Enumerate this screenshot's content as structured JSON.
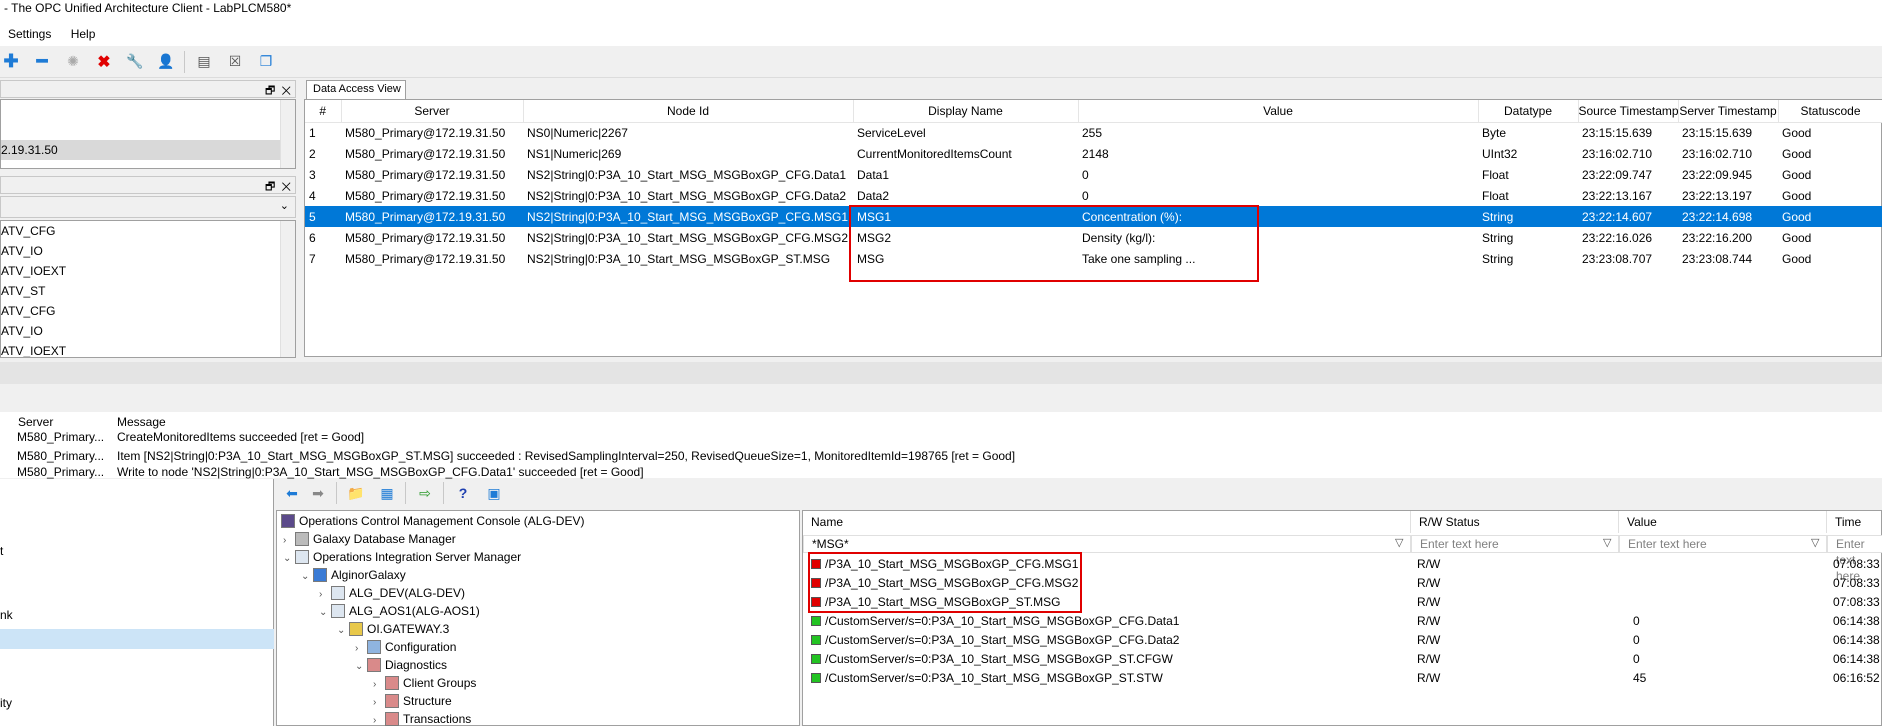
{
  "window": {
    "title": "- The OPC Unified Architecture Client - LabPLCM580*"
  },
  "menu": {
    "items": [
      "Settings",
      "Help"
    ]
  },
  "toolbar": {
    "icons": [
      "add-icon",
      "remove-icon",
      "connect-icon",
      "disconnect-icon",
      "wrench-icon",
      "user-icon",
      "document-icon",
      "delete-doc-icon",
      "window-icon"
    ]
  },
  "left_panel_top": {
    "selected_item": "2.19.31.50"
  },
  "left_panel_tree": {
    "items": [
      "ATV_CFG",
      "ATV_IO",
      "ATV_IOEXT",
      "ATV_ST",
      "ATV_CFG",
      "ATV_IO",
      "ATV_IOEXT"
    ]
  },
  "dav": {
    "tab": "Data Access View",
    "columns": [
      "#",
      "Server",
      "Node Id",
      "Display Name",
      "Value",
      "Datatype",
      "Source Timestamp",
      "Server Timestamp",
      "Statuscode"
    ],
    "rows": [
      [
        "1",
        "M580_Primary@172.19.31.50",
        "NS0|Numeric|2267",
        "ServiceLevel",
        "255",
        "Byte",
        "23:15:15.639",
        "23:15:15.639",
        "Good"
      ],
      [
        "2",
        "M580_Primary@172.19.31.50",
        "NS1|Numeric|269",
        "CurrentMonitoredItemsCount",
        "2148",
        "UInt32",
        "23:16:02.710",
        "23:16:02.710",
        "Good"
      ],
      [
        "3",
        "M580_Primary@172.19.31.50",
        "NS2|String|0:P3A_10_Start_MSG_MSGBoxGP_CFG.Data1",
        "Data1",
        "0",
        "Float",
        "23:22:09.747",
        "23:22:09.945",
        "Good"
      ],
      [
        "4",
        "M580_Primary@172.19.31.50",
        "NS2|String|0:P3A_10_Start_MSG_MSGBoxGP_CFG.Data2",
        "Data2",
        "0",
        "Float",
        "23:22:13.167",
        "23:22:13.197",
        "Good"
      ],
      [
        "5",
        "M580_Primary@172.19.31.50",
        "NS2|String|0:P3A_10_Start_MSG_MSGBoxGP_CFG.MSG1",
        "MSG1",
        "Concentration (%):",
        "String",
        "23:22:14.607",
        "23:22:14.698",
        "Good"
      ],
      [
        "6",
        "M580_Primary@172.19.31.50",
        "NS2|String|0:P3A_10_Start_MSG_MSGBoxGP_CFG.MSG2",
        "MSG2",
        "Density (kg/l):",
        "String",
        "23:22:16.026",
        "23:22:16.200",
        "Good"
      ],
      [
        "7",
        "M580_Primary@172.19.31.50",
        "NS2|String|0:P3A_10_Start_MSG_MSGBoxGP_ST.MSG",
        "MSG",
        "Take one sampling ...",
        "String",
        "23:23:08.707",
        "23:23:08.744",
        "Good"
      ]
    ]
  },
  "log": {
    "columns": [
      "Server",
      "Message"
    ],
    "rows": [
      [
        "M580_Primary...",
        "CreateMonitoredItems succeeded [ret = Good]"
      ],
      [
        "M580_Primary...",
        "Item [NS2|String|0:P3A_10_Start_MSG_MSGBoxGP_ST.MSG] succeeded : RevisedSamplingInterval=250, RevisedQueueSize=1, MonitoredItemId=198765 [ret = Good]"
      ],
      [
        "M580_Primary...",
        "Write to node 'NS2|String|0:P3A_10_Start_MSG_MSGBoxGP_CFG.Data1' succeeded [ret = Good]"
      ]
    ]
  },
  "leftnav": {
    "fragments": [
      "t",
      "nk",
      "ity"
    ]
  },
  "omc_tree": {
    "items": [
      "Operations Control Management Console (ALG-DEV)",
      "Galaxy Database Manager",
      "Operations Integration Server Manager",
      "AlginorGalaxy",
      "ALG_DEV(ALG-DEV)",
      "ALG_AOS1(ALG-AOS1)",
      "OI.GATEWAY.3",
      "Configuration",
      "Diagnostics",
      "Client Groups",
      "Structure",
      "Transactions"
    ]
  },
  "browse": {
    "columns": [
      "Name",
      "R/W Status",
      "Value",
      "Time"
    ],
    "filter_name": "*MSG*",
    "filter_placeholder": "Enter text here",
    "rows": [
      {
        "name": "/P3A_10_Start_MSG_MSGBoxGP_CFG.MSG1",
        "rw": "R/W",
        "value": "",
        "time": "07:08:33",
        "status": "bad"
      },
      {
        "name": "/P3A_10_Start_MSG_MSGBoxGP_CFG.MSG2",
        "rw": "R/W",
        "value": "",
        "time": "07:08:33",
        "status": "bad"
      },
      {
        "name": "/P3A_10_Start_MSG_MSGBoxGP_ST.MSG",
        "rw": "R/W",
        "value": "",
        "time": "07:08:33",
        "status": "bad"
      },
      {
        "name": "/CustomServer/s=0:P3A_10_Start_MSG_MSGBoxGP_CFG.Data1",
        "rw": "R/W",
        "value": "0",
        "time": "06:14:38",
        "status": "good"
      },
      {
        "name": "/CustomServer/s=0:P3A_10_Start_MSG_MSGBoxGP_CFG.Data2",
        "rw": "R/W",
        "value": "0",
        "time": "06:14:38",
        "status": "good"
      },
      {
        "name": "/CustomServer/s=0:P3A_10_Start_MSG_MSGBoxGP_ST.CFGW",
        "rw": "R/W",
        "value": "0",
        "time": "06:14:38",
        "status": "good"
      },
      {
        "name": "/CustomServer/s=0:P3A_10_Start_MSG_MSGBoxGP_ST.STW",
        "rw": "R/W",
        "value": "45",
        "time": "06:16:52",
        "status": "good"
      }
    ]
  },
  "colors": {
    "selection": "#0078d7",
    "highlight_box": "#e00000",
    "status_good": "#22c322",
    "status_bad": "#e00000"
  }
}
